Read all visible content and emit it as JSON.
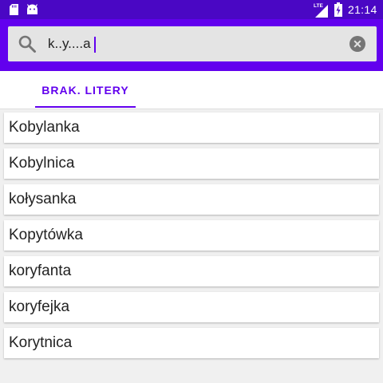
{
  "status_bar": {
    "time": "21:14",
    "network": "LTE",
    "icons": [
      "sd-card-icon",
      "android-icon",
      "lte-signal-icon",
      "battery-charging-icon"
    ]
  },
  "search": {
    "value": "k..y....a",
    "icon": "search-icon",
    "clear_icon": "clear-icon"
  },
  "tabs": [
    {
      "label": "BRAK. LITERY",
      "selected": true
    }
  ],
  "results": [
    "Kobylanka",
    "Kobylnica",
    "kołysanka",
    "Kopytówka",
    "koryfanta",
    "koryfejka",
    "Korytnica"
  ],
  "colors": {
    "status_bar": "#4a07c4",
    "app_bar": "#6200ee",
    "accent": "#6200ee",
    "search_box": "#e4e4e4"
  }
}
